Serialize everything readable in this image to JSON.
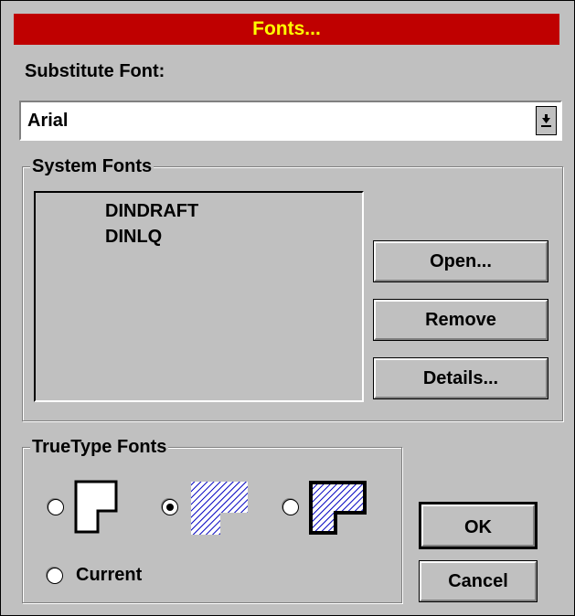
{
  "window": {
    "title": "Fonts...",
    "title_bg": "#bf0000",
    "title_fg": "#ffff00"
  },
  "substitute": {
    "label": "Substitute Font:",
    "value": "Arial"
  },
  "system_fonts": {
    "group_title": "System Fonts",
    "items": [
      "DINDRAFT",
      "DINLQ"
    ],
    "buttons": {
      "open": "Open...",
      "remove": "Remove",
      "details": "Details..."
    }
  },
  "truetype": {
    "group_title": "TrueType Fonts",
    "options": [
      {
        "name": "outline",
        "icon": "outline-shape-icon",
        "selected": false
      },
      {
        "name": "hatched",
        "icon": "hatched-shape-icon",
        "selected": true
      },
      {
        "name": "filled-hatched",
        "icon": "outlined-hatched-shape-icon",
        "selected": false
      }
    ],
    "current_label": "Current"
  },
  "dialog_buttons": {
    "ok": "OK",
    "cancel": "Cancel"
  }
}
